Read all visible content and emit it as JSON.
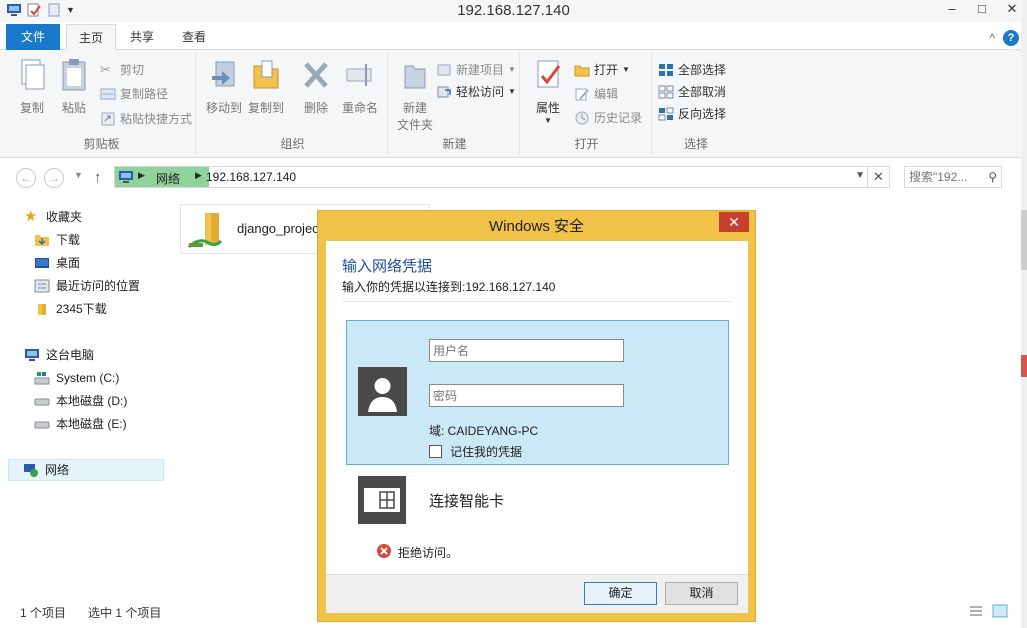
{
  "window": {
    "title": "192.168.127.140",
    "minimize": "–",
    "maximize": "□",
    "close": "✕"
  },
  "ribbon": {
    "tabs": {
      "file": "文件",
      "home": "主页",
      "share": "共享",
      "view": "查看"
    },
    "help": "?",
    "collapse": "^",
    "clipboard": {
      "label": "剪贴板",
      "copy": "复制",
      "paste": "粘贴",
      "cut": "剪切",
      "copy_path": "复制路径",
      "paste_shortcut": "粘贴快捷方式"
    },
    "organize": {
      "label": "组织",
      "move_to": "移动到",
      "copy_to": "复制到",
      "delete": "删除",
      "rename": "重命名"
    },
    "new": {
      "label": "新建",
      "new_folder_l1": "新建",
      "new_folder_l2": "文件夹",
      "new_item": "新建项目",
      "easy_access": "轻松访问"
    },
    "open": {
      "label": "打开",
      "properties": "属性",
      "open": "打开",
      "edit": "编辑",
      "history": "历史记录"
    },
    "select": {
      "label": "选择",
      "select_all": "全部选择",
      "select_none": "全部取消",
      "invert": "反向选择"
    }
  },
  "address": {
    "crumb_network": "网络",
    "crumb_host": "192.168.127.140",
    "search_placeholder": "搜索\"192...",
    "back": "←",
    "forward": "→",
    "up": "↑"
  },
  "nav": {
    "favorites": "收藏夹",
    "downloads": "下载",
    "desktop": "桌面",
    "recent": "最近访问的位置",
    "downloads_2345": "2345下载",
    "this_pc": "这台电脑",
    "system_c": "System (C:)",
    "disk_d": "本地磁盘 (D:)",
    "disk_e": "本地磁盘 (E:)",
    "network": "网络"
  },
  "content": {
    "item_name": "django_project"
  },
  "status": {
    "items": "1 个项目",
    "selected": "选中 1 个项目"
  },
  "dialog": {
    "title": "Windows 安全",
    "close": "✕",
    "heading": "输入网络凭据",
    "subheading": "输入你的凭据以连接到:192.168.127.140",
    "username_placeholder": "用户名",
    "password_placeholder": "密码",
    "domain": "域: CAIDEYANG-PC",
    "remember": "记住我的凭据",
    "smartcard": "连接智能卡",
    "error": "拒绝访问。",
    "ok": "确定",
    "cancel": "取消"
  },
  "colors": {
    "accent": "#1979ca",
    "dialog_frame": "#f0c248",
    "close_red": "#c7402d",
    "cred_bg": "#cbe8f6",
    "breadcrumb_highlight": "#8fd39b"
  }
}
